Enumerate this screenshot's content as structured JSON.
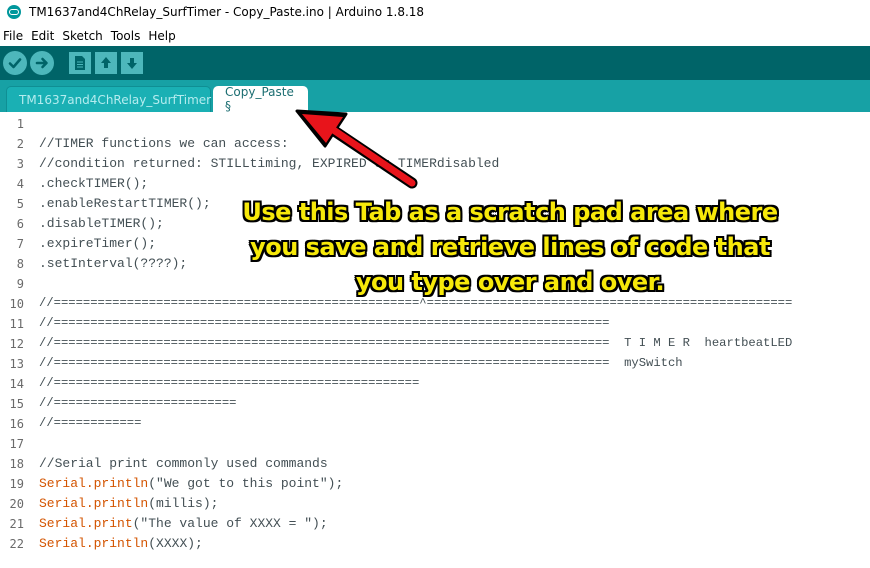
{
  "window": {
    "title": "TM1637and4ChRelay_SurfTimer - Copy_Paste.ino | Arduino 1.8.18"
  },
  "menu": {
    "items": [
      "File",
      "Edit",
      "Sketch",
      "Tools",
      "Help"
    ]
  },
  "toolbar": {
    "buttons": [
      {
        "name": "verify",
        "icon": "check-icon"
      },
      {
        "name": "upload",
        "icon": "arrow-right-icon"
      },
      {
        "name": "new",
        "icon": "new-file-icon"
      },
      {
        "name": "open",
        "icon": "arrow-up-icon"
      },
      {
        "name": "save",
        "icon": "arrow-down-icon"
      }
    ]
  },
  "tabs": [
    {
      "label": "TM1637and4ChRelay_SurfTimer",
      "active": false
    },
    {
      "label": "Copy_Paste §",
      "active": true
    }
  ],
  "editor": {
    "lines": [
      {
        "n": "1",
        "text": ""
      },
      {
        "n": "2",
        "text": "//TIMER functions we can access:"
      },
      {
        "n": "3",
        "text": "//condition returned: STILLtiming, EXPIRED or TIMERdisabled"
      },
      {
        "n": "4",
        "text": ".checkTIMER();"
      },
      {
        "n": "5",
        "text": ".enableRestartTIMER();"
      },
      {
        "n": "6",
        "text": ".disableTIMER();"
      },
      {
        "n": "7",
        "text": ".expireTimer();"
      },
      {
        "n": "8",
        "text": ".setInterval(????);"
      },
      {
        "n": "9",
        "text": ""
      },
      {
        "n": "10",
        "text": "//==================================================^=================================================="
      },
      {
        "n": "11",
        "text": "//============================================================================"
      },
      {
        "n": "12",
        "text": "//============================================================================  T I M E R  heartbeatLED"
      },
      {
        "n": "13",
        "text": "//============================================================================  mySwitch"
      },
      {
        "n": "14",
        "text": "//=================================================="
      },
      {
        "n": "15",
        "text": "//========================="
      },
      {
        "n": "16",
        "text": "//============"
      },
      {
        "n": "17",
        "text": ""
      },
      {
        "n": "18",
        "text": "//Serial print commonly used commands"
      },
      {
        "n": "19",
        "obj": "Serial",
        "method": ".println",
        "rest": "(\"We got to this point\");"
      },
      {
        "n": "20",
        "obj": "Serial",
        "method": ".println",
        "rest": "(millis);"
      },
      {
        "n": "21",
        "obj": "Serial",
        "method": ".print",
        "rest": "(\"The value of XXXX = \");"
      },
      {
        "n": "22",
        "obj": "Serial",
        "method": ".println",
        "rest": "(XXXX);"
      }
    ]
  },
  "annotation": {
    "lines": [
      "Use this Tab as a scratch pad area where",
      "you save and retrieve lines of code that",
      "you type over and over."
    ],
    "text_color": "#f7e90a",
    "arrow_color": "#e8141b"
  },
  "colors": {
    "toolbar": "#006468",
    "tabbar": "#17a1a5",
    "keyword": "#d35400"
  }
}
